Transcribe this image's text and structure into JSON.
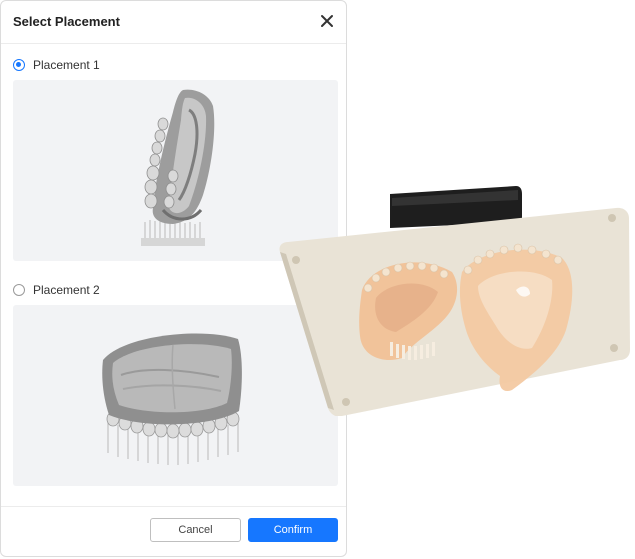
{
  "dialog": {
    "title": "Select Placement",
    "close_icon": "close-icon",
    "options": [
      {
        "label": "Placement 1",
        "selected": true
      },
      {
        "label": "Placement 2",
        "selected": false
      }
    ],
    "footer": {
      "cancel_label": "Cancel",
      "confirm_label": "Confirm"
    }
  },
  "colors": {
    "accent": "#1677ff",
    "preview_bg": "#f2f3f5",
    "plate": "#ece7dc",
    "resin": "#f3c9a2"
  }
}
